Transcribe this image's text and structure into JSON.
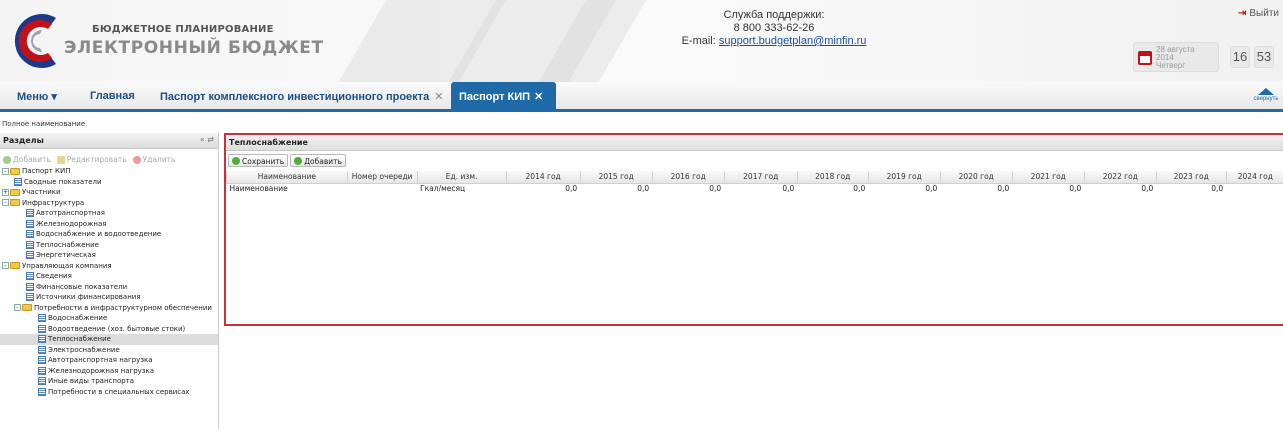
{
  "header": {
    "logo_top": "БЮДЖЕТНОЕ ПЛАНИРОВАНИЕ",
    "logo_bottom": "ЭЛЕКТРОННЫЙ БЮДЖЕТ",
    "support_title": "Служба поддержки:",
    "support_phone": "8 800 333-62-26",
    "support_email_label": "E-mail:",
    "support_email": "support.budgetplan@minfin.ru",
    "logout_label": "Выйти",
    "date_day": "28 августа",
    "date_year": "2014",
    "date_weekday": "Четверг",
    "time_hours": "16",
    "time_minutes": "53",
    "brand_color": "#c0121b",
    "accent_color": "#1e6aa8"
  },
  "nav": {
    "menu_label": "Меню ▾",
    "home_label": "Главная",
    "tab_project": "Паспорт комплексного инвестиционного проекта",
    "tab_active": "Паспорт КИП",
    "close_glyph": "✕",
    "collapse_label": "свернуть"
  },
  "fullname_label": "Полное наименование",
  "sections": {
    "title": "Разделы",
    "tools": "« ⇄",
    "add_label": "Добавить",
    "edit_label": "Редактировать",
    "delete_label": "Удалить",
    "tree": [
      {
        "label": "Паспорт КИП",
        "type": "folder",
        "level": 0,
        "toggle": "-"
      },
      {
        "label": "Сводные показатели",
        "type": "leaf",
        "level": 1
      },
      {
        "label": "Участники",
        "type": "folder",
        "level": 0,
        "toggle": "+"
      },
      {
        "label": "Инфраструктура",
        "type": "folder",
        "level": 0,
        "toggle": "-"
      },
      {
        "label": "Автотранспортная",
        "type": "leaf",
        "level": 2
      },
      {
        "label": "Железнодорожная",
        "type": "leaf",
        "level": 2
      },
      {
        "label": "Водоснабжение и водоотведение",
        "type": "leaf",
        "level": 2
      },
      {
        "label": "Теплоснабжение",
        "type": "leaf",
        "level": 2
      },
      {
        "label": "Энергетическая",
        "type": "leaf",
        "level": 2
      },
      {
        "label": "Управляющая компания",
        "type": "folder",
        "level": 0,
        "toggle": "-"
      },
      {
        "label": "Сведения",
        "type": "leaf",
        "level": 2
      },
      {
        "label": "Финансовые показатели",
        "type": "leaf",
        "level": 2
      },
      {
        "label": "Источники финансирования",
        "type": "leaf",
        "level": 2
      },
      {
        "label": "Потребности в инфраструктурном обеспечении",
        "type": "folder",
        "level": 1,
        "toggle": "-"
      },
      {
        "label": "Водоснабжение",
        "type": "leaf",
        "level": 3
      },
      {
        "label": "Водоотведение (хоз. бытовые стоки)",
        "type": "leaf",
        "level": 3
      },
      {
        "label": "Теплоснабжение",
        "type": "leaf",
        "level": 3,
        "selected": true
      },
      {
        "label": "Электроснабжение",
        "type": "leaf",
        "level": 3
      },
      {
        "label": "Автотранспортная нагрузка",
        "type": "leaf",
        "level": 3
      },
      {
        "label": "Железнодорожная нагрузка",
        "type": "leaf",
        "level": 3
      },
      {
        "label": "Иные виды транспорта",
        "type": "leaf",
        "level": 3
      },
      {
        "label": "Потребности в специальных сервисах",
        "type": "leaf",
        "level": 3
      }
    ]
  },
  "detail": {
    "title": "Теплоснабжение",
    "save_label": "Сохранить",
    "add_label": "Добавить",
    "columns": [
      "Наименование",
      "Номер очереди",
      "Ед. изм.",
      "2014 год",
      "2015 год",
      "2016 год",
      "2017 год",
      "2018 год",
      "2019 год",
      "2020 год",
      "2021 год",
      "2022 год",
      "2023 год",
      "2024 год"
    ],
    "rows": [
      [
        "Наименование",
        "",
        "Гкал/месяц",
        "0,0",
        "0,0",
        "0,0",
        "0,0",
        "0,0",
        "0,0",
        "0,0",
        "0,0",
        "0,0",
        "0,0",
        ""
      ]
    ]
  }
}
